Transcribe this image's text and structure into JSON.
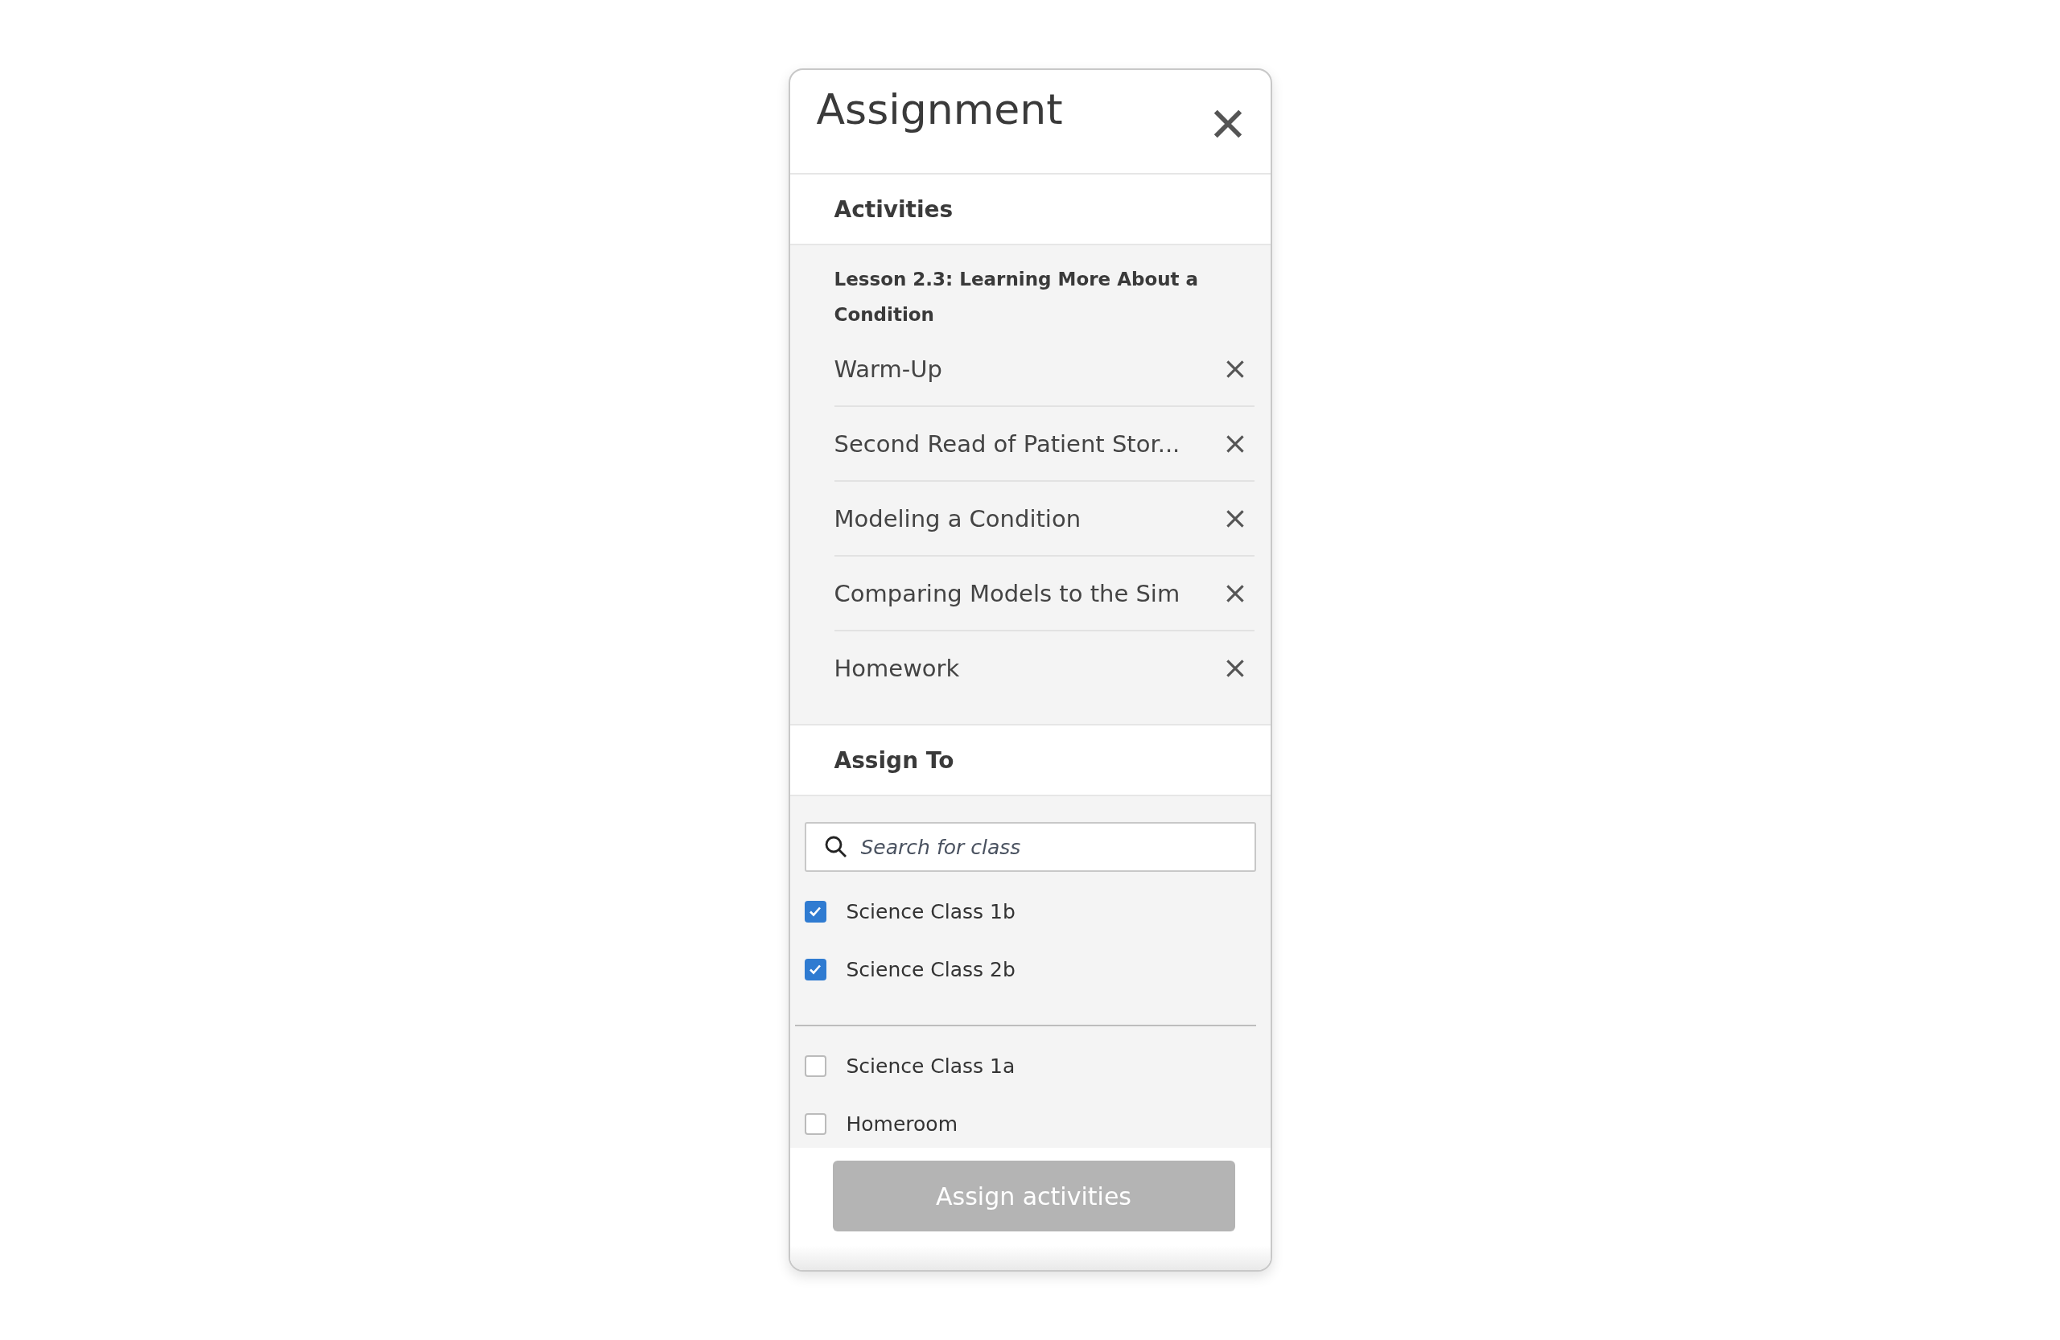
{
  "dialog": {
    "title": "Assignment"
  },
  "activities": {
    "heading": "Activities",
    "lesson": "Lesson 2.3: Learning More About a Condition",
    "items": [
      {
        "label": "Warm-Up"
      },
      {
        "label": "Second Read of Patient Stor..."
      },
      {
        "label": "Modeling a Condition"
      },
      {
        "label": "Comparing Models to the Sim"
      },
      {
        "label": "Homework"
      }
    ]
  },
  "assign_to": {
    "heading": "Assign To",
    "search": {
      "placeholder": "Search for class"
    },
    "groups": [
      [
        {
          "label": "Science Class 1b",
          "checked": true
        },
        {
          "label": "Science Class 2b",
          "checked": true
        }
      ],
      [
        {
          "label": "Science Class 1a",
          "checked": false
        },
        {
          "label": "Homeroom",
          "checked": false
        }
      ]
    ]
  },
  "button": {
    "label": "Assign activities",
    "disabled": true
  }
}
